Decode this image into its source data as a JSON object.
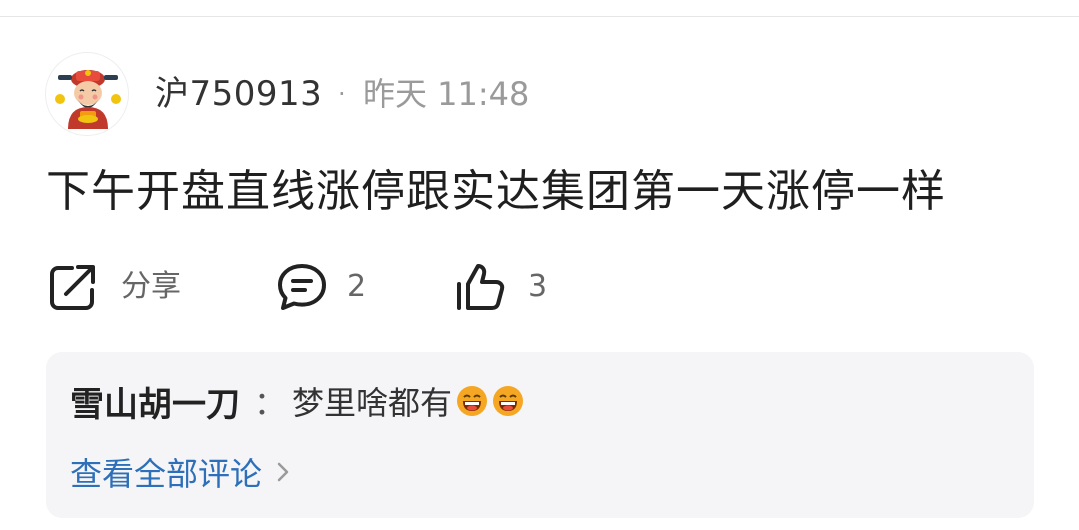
{
  "post": {
    "username": "沪750913",
    "separator": "·",
    "time": "昨天 11:48",
    "text": "下午开盘直线涨停跟实达集团第一天涨停一样",
    "avatar_icon": "fortune-god-avatar"
  },
  "actions": {
    "share_label": "分享",
    "comment_count": "2",
    "like_count": "3"
  },
  "comments": {
    "author": "雪山胡一刀",
    "colon": "：",
    "text": "梦里啥都有",
    "emojis": [
      "laughing-emoji",
      "laughing-emoji"
    ],
    "view_all_label": "查看全部评论"
  },
  "colors": {
    "link": "#2d6fb8",
    "muted": "#9a9a9a",
    "comment_bg": "#f5f5f7"
  }
}
